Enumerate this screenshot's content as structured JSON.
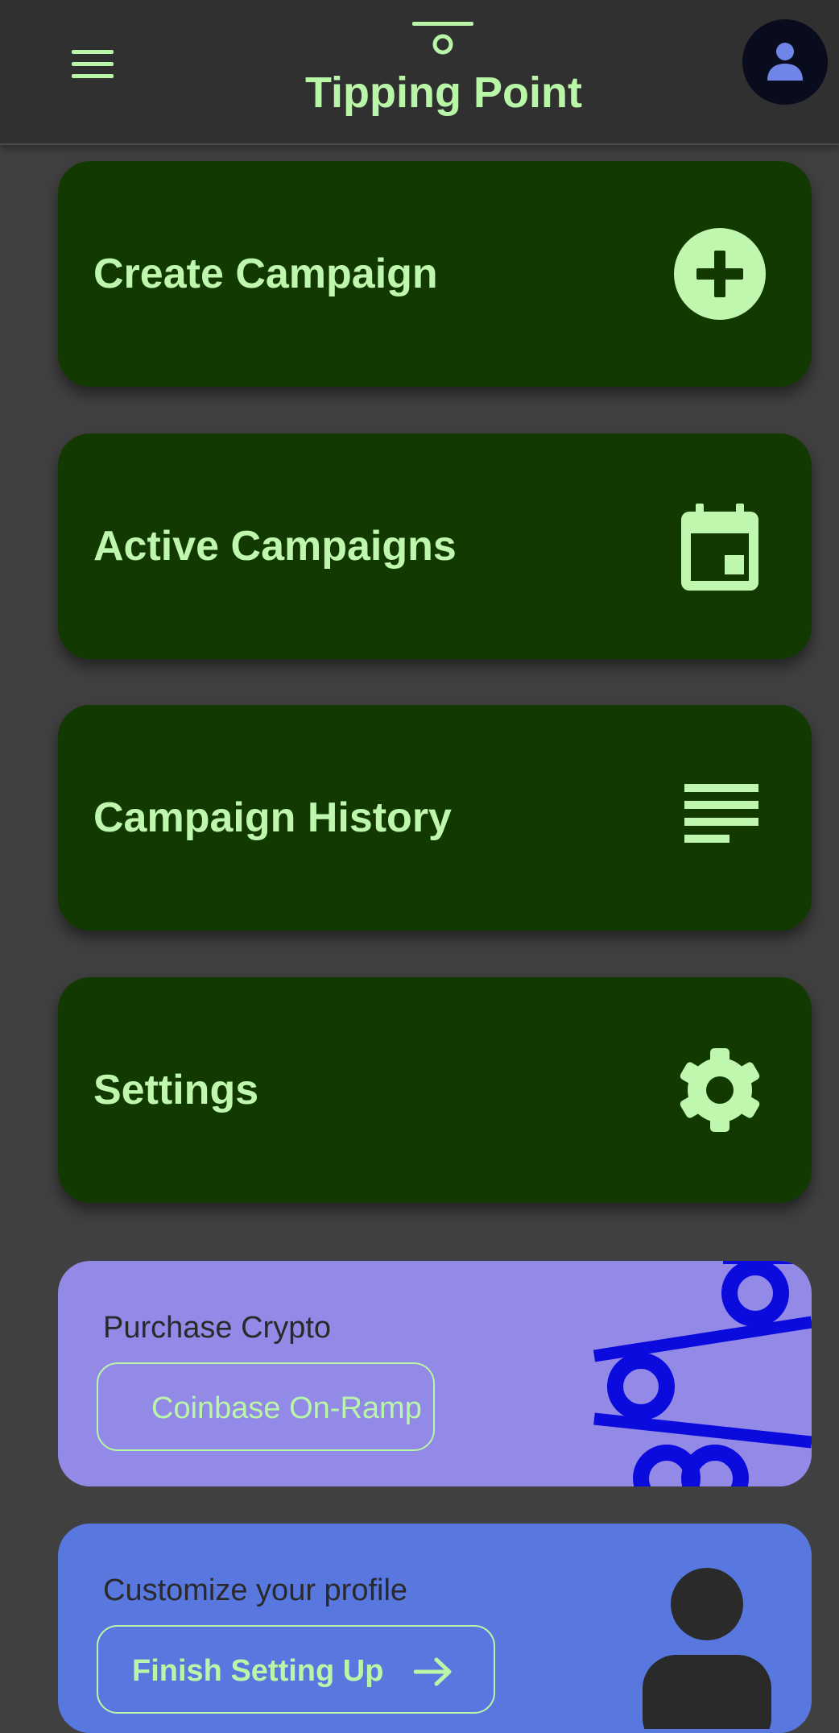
{
  "app": {
    "title": "Tipping Point"
  },
  "header": {
    "menu_icon": "hamburger-menu-icon",
    "logo_icon": "tipping-point-logo-icon",
    "avatar_icon": "person-icon"
  },
  "menu": {
    "items": [
      {
        "label": "Create Campaign",
        "icon": "add-circle-icon"
      },
      {
        "label": "Active Campaigns",
        "icon": "calendar-icon"
      },
      {
        "label": "Campaign History",
        "icon": "list-lines-icon"
      },
      {
        "label": "Settings",
        "icon": "gear-icon"
      }
    ]
  },
  "promos": {
    "crypto": {
      "title": "Purchase Crypto",
      "button_label": "Coinbase On-Ramp"
    },
    "profile": {
      "title": "Customize your profile",
      "button_label": "Finish Setting Up"
    }
  },
  "colors": {
    "background": "#404040",
    "appbar": "#303030",
    "accent_text": "#b9f6a8",
    "menu_card": "#123a00",
    "crypto_card": "#9389e6",
    "crypto_art": "#0b0bdd",
    "profile_card": "#5878e0"
  }
}
